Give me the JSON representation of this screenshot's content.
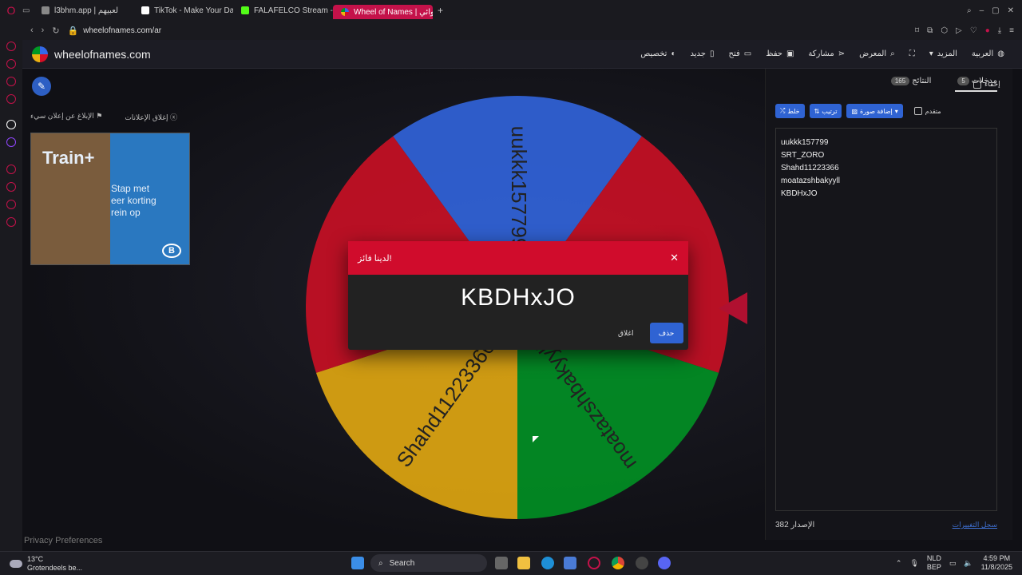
{
  "browser": {
    "tabs": [
      {
        "label": "l3bhm.app | لعبيهم",
        "color": "#888888"
      },
      {
        "label": "TikTok - Make Your Day",
        "color": "#ffffff"
      },
      {
        "label": "FALAFELCO Stream - Wa",
        "color": "#53fc18"
      },
      {
        "label": "Wheel of Names | عشوائي",
        "color": "#ffffff"
      }
    ],
    "new_tab": "+",
    "url": "wheelofnames.com/ar"
  },
  "app": {
    "site_name": "wheelofnames.com",
    "menu": {
      "language": "العربية",
      "more": "المزيد",
      "gallery": "المعرض",
      "share": "مشاركة",
      "save": "حفظ",
      "open": "فتح",
      "new": "جديد",
      "customize": "تخصيص"
    }
  },
  "ad": {
    "close_ads": "إغلاق الإعلانات",
    "report_ad": "الإبلاغ عن إعلان سيء",
    "headline": "Train+",
    "body_line1": "Stap met",
    "body_line2": "eer korting",
    "body_line3": "rein op",
    "brand_mark": "B"
  },
  "wheel": {
    "segments": [
      {
        "name": "uukkk157799",
        "color": "#3369e8"
      },
      {
        "name": "KBDHxJO",
        "color": "#d50f25"
      },
      {
        "name": "moatazshbakyyll",
        "color": "#009925"
      },
      {
        "name": "Shahd11223366",
        "color": "#eeb211"
      },
      {
        "name": "SRT_ZORO",
        "color": "#d50f25"
      }
    ]
  },
  "sidebar": {
    "tab_entries": "مدخلات",
    "entries_count": "5",
    "tab_results": "النتائج",
    "results_count": "165",
    "hide_label": "إخفاء",
    "shuffle": "خلط",
    "sort": "ترتيب",
    "add_image": "إضافة صورة",
    "advanced": "متقدم",
    "entries": [
      "uukkk157799",
      "SRT_ZORO",
      "Shahd11223366",
      "moatazshbakyyll",
      "KBDHxJO"
    ],
    "version": "الإصدار 382",
    "changelog": "سجل التغييرات"
  },
  "modal": {
    "title": "لدينا فائز!",
    "winner": "KBDHxJO",
    "remove": "حذف",
    "close": "اغلاق"
  },
  "privacy": "Privacy Preferences",
  "taskbar": {
    "temperature": "13°C",
    "weather": "Grotendeels be...",
    "search": "Search",
    "lang1": "NLD",
    "lang2": "BEP",
    "time": "4:59 PM",
    "date": "11/8/2025"
  }
}
